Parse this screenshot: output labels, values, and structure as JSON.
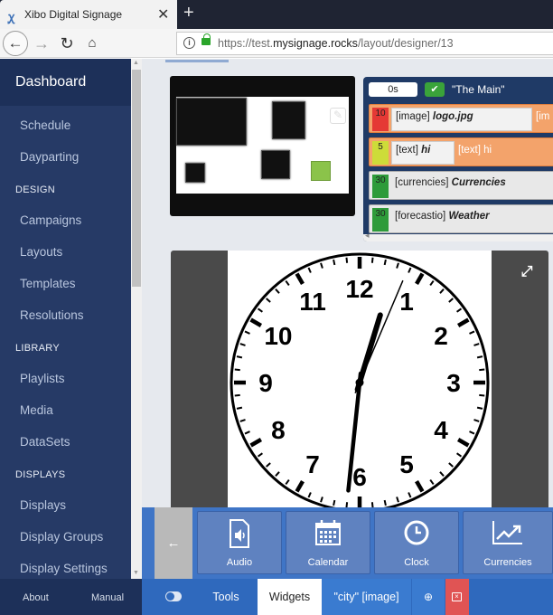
{
  "browser": {
    "tab_title": "Xibo Digital Signage",
    "url_prefix": "https://test.",
    "url_domain": "mysignage.rocks",
    "url_path": "/layout/designer/13"
  },
  "sidebar": {
    "dashboard": "Dashboard",
    "items": {
      "schedule": "Schedule",
      "dayparting": "Dayparting",
      "campaigns": "Campaigns",
      "layouts": "Layouts",
      "templates": "Templates",
      "resolutions": "Resolutions",
      "playlists": "Playlists",
      "media": "Media",
      "datasets": "DataSets",
      "displays": "Displays",
      "display_groups": "Display Groups",
      "display_settings": "Display Settings"
    },
    "sections": {
      "design": "DESIGN",
      "library": "LIBRARY",
      "displays": "DISPLAYS"
    },
    "footer": {
      "about": "About",
      "manual": "Manual"
    }
  },
  "timeline": {
    "time": "0s",
    "region_name": "\"The Main\"",
    "rows": [
      {
        "num": "10",
        "type": "[image]",
        "name": "logo.jpg",
        "ghost": "[im",
        "color": "#e53935"
      },
      {
        "num": "5",
        "type": "[text]",
        "name": "hi",
        "ghost": "[text] hi",
        "color": "#cddc39"
      },
      {
        "num": "30",
        "type": "[currencies]",
        "name": "Currencies",
        "ghost": "",
        "color": "#2e9b3a"
      },
      {
        "num": "30",
        "type": "[forecastio]",
        "name": "Weather",
        "ghost": "",
        "color": "#2e9b3a"
      }
    ]
  },
  "clock": {
    "numerals": [
      "12",
      "1",
      "2",
      "3",
      "4",
      "5",
      "6",
      "7",
      "8",
      "9",
      "10",
      "11"
    ],
    "hour_hand_deg": 17,
    "minute_hand_deg": 186,
    "second_hand_deg": 23
  },
  "widgets": {
    "collapse_icon": "arrow-left-icon",
    "items": [
      {
        "label": "Audio",
        "icon": "audio-file-icon"
      },
      {
        "label": "Calendar",
        "icon": "calendar-icon"
      },
      {
        "label": "Clock",
        "icon": "clock-icon"
      },
      {
        "label": "Currencies",
        "icon": "chart-line-icon"
      }
    ]
  },
  "bottombar": {
    "tools": "Tools",
    "widgets": "Widgets",
    "selected": "\"city\" [image]"
  },
  "colors": {
    "sidebar": "#263a66",
    "accent": "#3f75c6",
    "delete": "#e05454"
  }
}
